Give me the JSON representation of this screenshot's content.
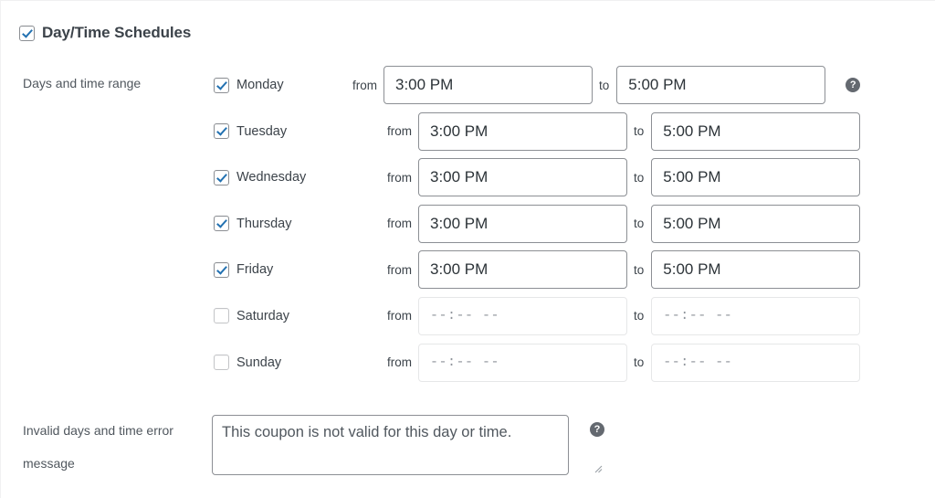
{
  "section": {
    "title": "Day/Time Schedules",
    "enabled": true
  },
  "fields": {
    "days_label": "Days and time range",
    "error_label": "Invalid days and time error message",
    "error_value": "This coupon is not valid for this day or time.",
    "from_label": "from",
    "to_label": "to",
    "empty_time_placeholder": "--:-- --"
  },
  "icons": {
    "help": "?",
    "help_name": "help-icon"
  },
  "colors": {
    "accent": "#2271b1",
    "text": "#3c434a",
    "label": "#50575e",
    "border": "#8c8f94",
    "border_disabled": "#e6e7e8",
    "help_bg": "#646970"
  },
  "schedule": [
    {
      "day": "Monday",
      "checked": true,
      "from": "3:00 PM",
      "to": "5:00 PM"
    },
    {
      "day": "Tuesday",
      "checked": true,
      "from": "3:00 PM",
      "to": "5:00 PM"
    },
    {
      "day": "Wednesday",
      "checked": true,
      "from": "3:00 PM",
      "to": "5:00 PM"
    },
    {
      "day": "Thursday",
      "checked": true,
      "from": "3:00 PM",
      "to": "5:00 PM"
    },
    {
      "day": "Friday",
      "checked": true,
      "from": "3:00 PM",
      "to": "5:00 PM"
    },
    {
      "day": "Saturday",
      "checked": false,
      "from": "--:-- --",
      "to": "--:-- --"
    },
    {
      "day": "Sunday",
      "checked": false,
      "from": "--:-- --",
      "to": "--:-- --"
    }
  ]
}
